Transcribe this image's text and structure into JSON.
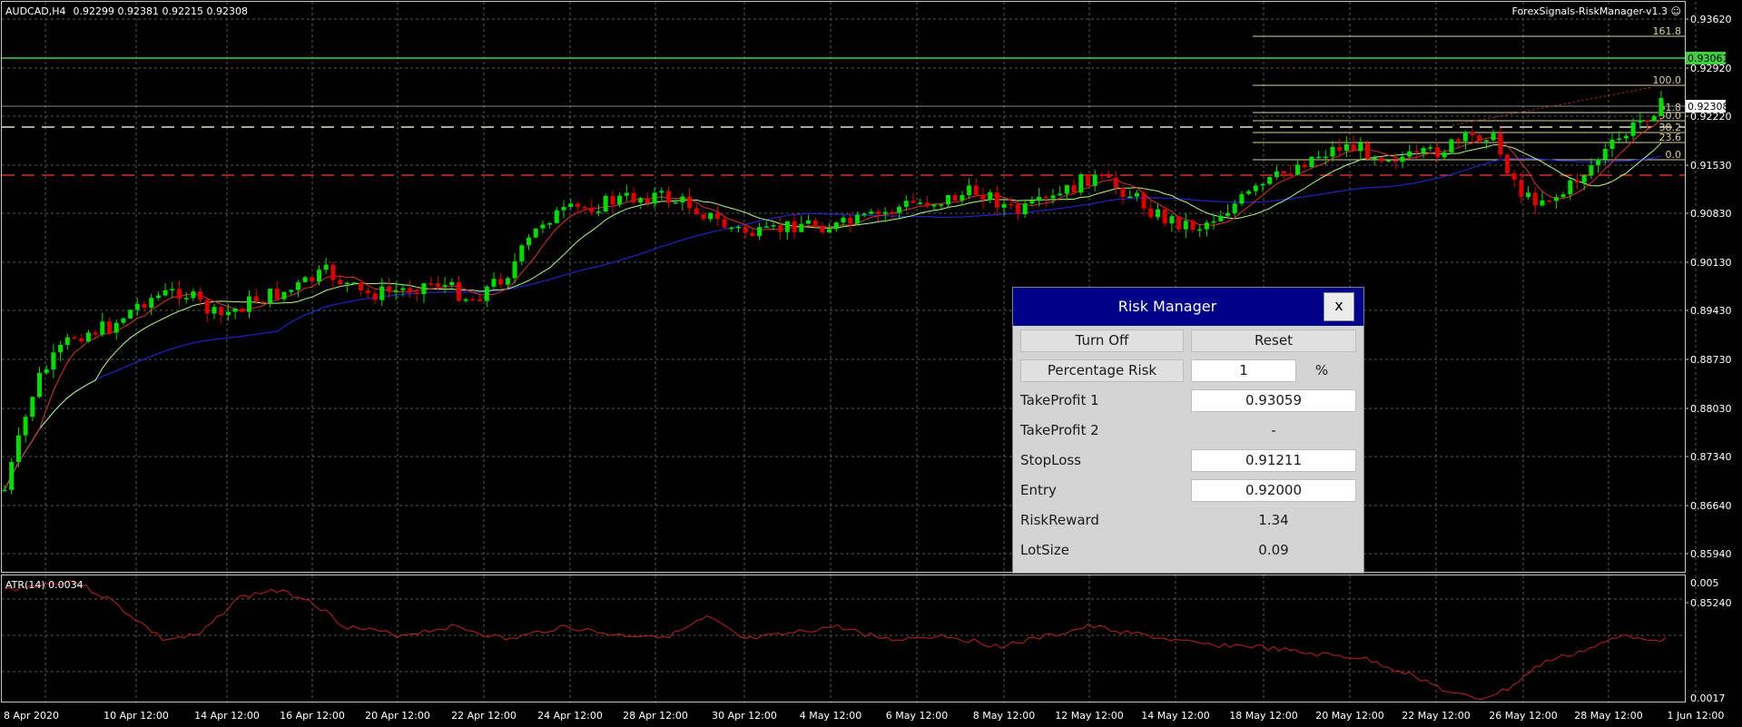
{
  "header": {
    "symbol": "AUDCAD,H4",
    "ohlc": "0.92299 0.92381 0.92215 0.92308",
    "indicator": "ForexSignals-RiskManager-v1.3 ☺"
  },
  "sub_indicator": {
    "label": "ATR(14) 0.0034",
    "axis_top": "0.005",
    "axis_bottom": "0.0017"
  },
  "price_axis": [
    "0.93620",
    "0.92920",
    "0.92220",
    "0.91530",
    "0.90830",
    "0.90130",
    "0.89430",
    "0.88730",
    "0.88030",
    "0.87340",
    "0.86640",
    "0.85940",
    "0.85240"
  ],
  "price_tags": {
    "tp": "0.93061",
    "current": "0.92308"
  },
  "fib_levels": [
    "161.8",
    "100.0",
    "61.8",
    "50.0",
    "38.2",
    "23.6",
    "0.0"
  ],
  "time_axis": [
    "8 Apr 2020",
    "10 Apr 12:00",
    "14 Apr 12:00",
    "16 Apr 12:00",
    "20 Apr 12:00",
    "22 Apr 12:00",
    "24 Apr 12:00",
    "28 Apr 12:00",
    "30 Apr 12:00",
    "4 May 12:00",
    "6 May 12:00",
    "8 May 12:00",
    "12 May 12:00",
    "14 May 12:00",
    "18 May 12:00",
    "20 May 12:00",
    "22 May 12:00",
    "26 May 12:00",
    "28 May 12:00",
    "1 Jun 12:00"
  ],
  "colors": {
    "bull": "#00e000",
    "bear": "#e00000",
    "grid": "#5a5a5a",
    "tp_line": "#3fcf3f",
    "entry_line": "#e0e0c0",
    "sl_line": "#d03030",
    "fib": "#d6d49a",
    "ma_fast": "#e03030",
    "ma_mid": "#b0ff80",
    "ma_slow": "#2222c8",
    "atr": "#c02020"
  },
  "risk_manager": {
    "title": "Risk Manager",
    "close_label": "x",
    "turn_off_label": "Turn Off",
    "reset_label": "Reset",
    "percentage_risk_label": "Percentage Risk",
    "percentage_risk_value": "1",
    "percent_sign": "%",
    "tp1_label": "TakeProfit 1",
    "tp1_value": "0.93059",
    "tp2_label": "TakeProfit 2",
    "tp2_value": "-",
    "sl_label": "StopLoss",
    "sl_value": "0.91211",
    "entry_label": "Entry",
    "entry_value": "0.92000",
    "rr_label": "RiskReward",
    "rr_value": "1.34",
    "lot_label": "LotSize",
    "lot_value": "0.09"
  }
}
